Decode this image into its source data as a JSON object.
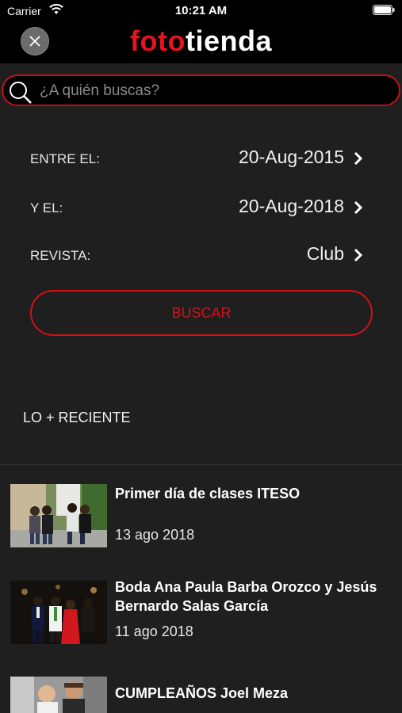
{
  "status_bar": {
    "carrier": "Carrier",
    "time": "10:21 AM"
  },
  "nav": {
    "brand_part1": "foto",
    "brand_part2": "tienda"
  },
  "search": {
    "placeholder": "¿A quién buscas?"
  },
  "filters": [
    {
      "label": "ENTRE EL:",
      "value": "20-Aug-2015"
    },
    {
      "label": "Y EL:",
      "value": "20-Aug-2018"
    },
    {
      "label": "REVISTA:",
      "value": "Club"
    }
  ],
  "search_button": "BUSCAR",
  "section_title": "LO + RECIENTE",
  "feed": [
    {
      "title": "Primer día de clases ITESO",
      "date": "13 ago 2018"
    },
    {
      "title": "Boda Ana Paula Barba Orozco y Jesús Bernardo Salas García",
      "date": "11 ago 2018"
    },
    {
      "title": "CUMPLEAÑOS Joel Meza",
      "date": ""
    }
  ],
  "colors": {
    "accent": "#e3141c",
    "background": "#1f1f1f",
    "bar": "#000000"
  }
}
